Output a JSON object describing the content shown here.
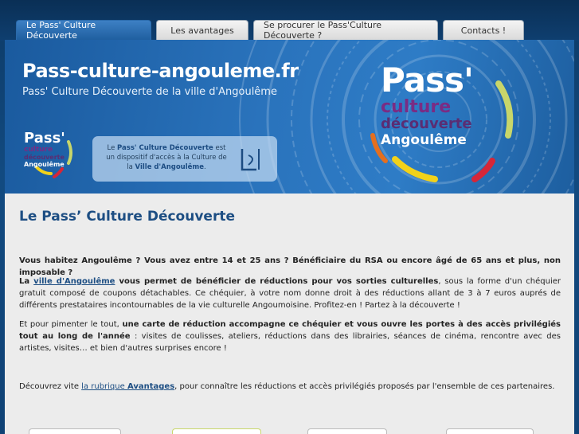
{
  "tabs": [
    {
      "label": "Le Pass' Culture Découverte",
      "active": true
    },
    {
      "label": "Les avantages",
      "active": false
    },
    {
      "label": "Se procurer le Pass'Culture Découverte ?",
      "active": false
    },
    {
      "label": "Contacts !",
      "active": false
    }
  ],
  "banner": {
    "title": "Pass-culture-angouleme.fr",
    "subtitle": "Pass' Culture Découverte de la ville d'Angoulême",
    "logo": {
      "pass": "Pass'",
      "culture": "culture",
      "decouverte": "découverte",
      "angouleme": "Angoulême"
    },
    "info": {
      "line_prefix": "Le ",
      "brand": "Pass' Culture Découverte",
      "line_suffix": " est un dispositif d'accès à la Culture de la ",
      "city": "Ville d'Angoulême",
      "end": "."
    }
  },
  "main": {
    "heading": "Le Pass’ Culture Découverte",
    "intro": "Vous habitez Angoulême ? Vous avez entre 14 et 25 ans ? Bénéficiaire du RSA ou encore âgé de 65 ans et plus, non imposable ?",
    "p2": {
      "lead": "La ",
      "link": "ville d'Angoulême",
      "bold": " vous permet de bénéficier de réductions pour vos sorties culturelles",
      "rest": ", sous la forme d'un chéquier gratuit composé de coupons détachables. Ce chéquier, à votre nom donne droit à des réductions allant de 3 à 7 euros auprés de différents prestataires incontournables de la vie culturelle Angoumoisine. Profitez-en ! Partez à la découverte !"
    },
    "p3": {
      "lead": "Et pour pimenter le tout, ",
      "bold": "une carte de réduction accompagne ce chéquier et vous ouvre les portes à des accès privilégiés tout au long de l'année",
      "rest": " : visites de coulisses, ateliers, réductions dans des librairies, séances de cinéma, rencontre avec des artistes, visites… et bien d'autres surprises encore !"
    },
    "p4": {
      "lead": "Découvrez vite ",
      "link_prefix": "la rubrique ",
      "link_bold": "Avantages",
      "rest": ", pour connaître les réductions et accès privilégiés proposés par l'ensemble de ces partenaires."
    }
  },
  "colors": {
    "accent": "#1d4e83",
    "tab_active": "#2a6aab",
    "banner": "#2a73bc"
  }
}
